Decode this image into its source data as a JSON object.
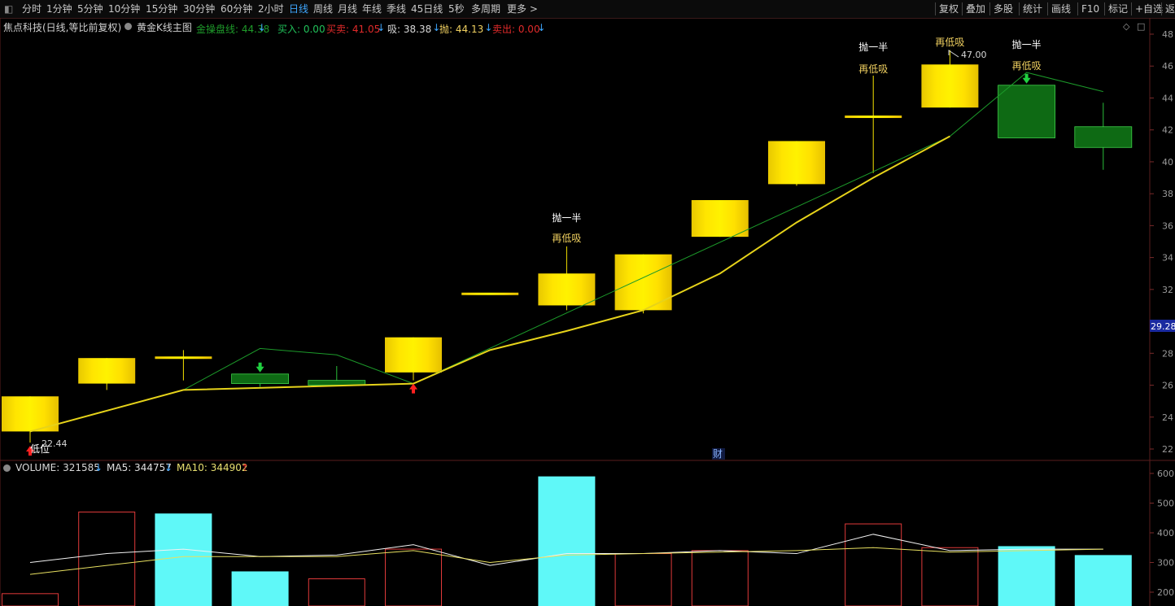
{
  "toolbar": {
    "periods": [
      "分时",
      "1分钟",
      "5分钟",
      "10分钟",
      "15分钟",
      "30分钟",
      "60分钟",
      "2小时",
      "日线",
      "周线",
      "月线",
      "年线",
      "季线",
      "45日线",
      "5秒",
      "多周期",
      "更多 >"
    ],
    "active": "日线",
    "right": [
      "复权",
      "叠加",
      "多股",
      "统计",
      "画线",
      "F10",
      "标记",
      "+自选",
      "返"
    ]
  },
  "info": {
    "stock": "焦点科技(日线,等比前复权)",
    "indicator": "黄金K线主图",
    "items": [
      {
        "label": "金操盘线: 44.38",
        "arrow": "↓",
        "color": "#1e9a2a"
      },
      {
        "label": "买入: 0.00",
        "arrow": "",
        "color": "#21c15a"
      },
      {
        "label": "买卖: 41.05",
        "arrow": "↓",
        "color": "#e02a2a"
      },
      {
        "label": "吸: 38.38",
        "arrow": "↓",
        "color": "#d8d8d8"
      },
      {
        "label": "抛: 44.13",
        "arrow": "↓",
        "color": "#f0d060"
      },
      {
        "label": "卖出: 0.00",
        "arrow": "↓",
        "color": "#e02a2a"
      }
    ]
  },
  "volume_info": {
    "volume": "VOLUME: 321585",
    "ma5": "MA5: 344757",
    "ma10": "MA10: 344902"
  },
  "price_axis": {
    "ticks": [
      22,
      24,
      26,
      28,
      32,
      34,
      36,
      38,
      40,
      42,
      44,
      46,
      48
    ],
    "current": "29.28"
  },
  "volume_axis": {
    "ticks": [
      200,
      300,
      400,
      500,
      600
    ]
  },
  "annotations": {
    "half_sell": "抛一半",
    "rebuy": "再低吸",
    "low_label": "低位",
    "low_value": "22.44",
    "high_value": "47.00",
    "finance_marker": "财"
  },
  "chart_data": {
    "type": "candlestick",
    "candles": [
      {
        "open": 23.1,
        "close": 25.3,
        "high": 25.3,
        "low": 22.4,
        "color": "yellow"
      },
      {
        "open": 26.1,
        "close": 27.7,
        "high": 27.7,
        "low": 25.7,
        "color": "yellow"
      },
      {
        "open": 27.8,
        "close": 27.8,
        "high": 28.2,
        "low": 26.3,
        "color": "yellow"
      },
      {
        "open": 26.7,
        "close": 26.1,
        "high": 26.7,
        "low": 25.9,
        "color": "green"
      },
      {
        "open": 26.3,
        "close": 26.0,
        "high": 27.2,
        "low": 26.0,
        "color": "green"
      },
      {
        "open": 26.8,
        "close": 29.0,
        "high": 29.0,
        "low": 26.3,
        "color": "yellow"
      },
      {
        "open": 31.8,
        "close": 31.8,
        "high": 31.8,
        "low": 31.8,
        "color": "yellow"
      },
      {
        "open": 31.0,
        "close": 33.0,
        "high": 34.7,
        "low": 30.7,
        "color": "yellow"
      },
      {
        "open": 30.7,
        "close": 34.2,
        "high": 34.2,
        "low": 30.5,
        "color": "yellow"
      },
      {
        "open": 35.3,
        "close": 37.6,
        "high": 37.6,
        "low": 35.3,
        "color": "yellow"
      },
      {
        "open": 38.6,
        "close": 41.3,
        "high": 41.3,
        "low": 38.5,
        "color": "yellow"
      },
      {
        "open": 42.9,
        "close": 42.9,
        "high": 45.4,
        "low": 39.3,
        "color": "yellow"
      },
      {
        "open": 43.4,
        "close": 46.1,
        "high": 47.0,
        "low": 43.4,
        "color": "yellow"
      },
      {
        "open": 44.8,
        "close": 41.5,
        "high": 44.8,
        "low": 41.5,
        "color": "green"
      },
      {
        "open": 42.2,
        "close": 40.9,
        "high": 43.7,
        "low": 39.5,
        "color": "green"
      }
    ],
    "gold_line": [
      23.1,
      24.4,
      25.7,
      null,
      null,
      26.1,
      28.2,
      29.4,
      30.7,
      33.0,
      36.2,
      39.0,
      41.6,
      null,
      null
    ],
    "green_line": [
      null,
      null,
      25.7,
      28.3,
      27.9,
      26.1,
      null,
      null,
      null,
      null,
      null,
      null,
      41.6,
      45.6,
      44.4
    ],
    "buy_markers": [
      0,
      5
    ],
    "sell_markers": [
      3,
      13
    ],
    "half_sell_labels": [
      7,
      11,
      13
    ],
    "volume": {
      "values": [
        195,
        470,
        465,
        270,
        245,
        345,
        0,
        590,
        330,
        340,
        0,
        430,
        350,
        355,
        325
      ],
      "colors": [
        "red",
        "red",
        "cyan",
        "cyan",
        "red",
        "red",
        "none",
        "cyan",
        "red",
        "red",
        "red",
        "red",
        "red",
        "cyan",
        "cyan"
      ],
      "ma5": [
        300,
        330,
        345,
        320,
        325,
        360,
        290,
        330,
        330,
        340,
        330,
        395,
        340,
        345,
        345
      ],
      "ma10": [
        260,
        290,
        320,
        320,
        320,
        340,
        300,
        325,
        330,
        335,
        340,
        350,
        335,
        340,
        345
      ]
    }
  }
}
